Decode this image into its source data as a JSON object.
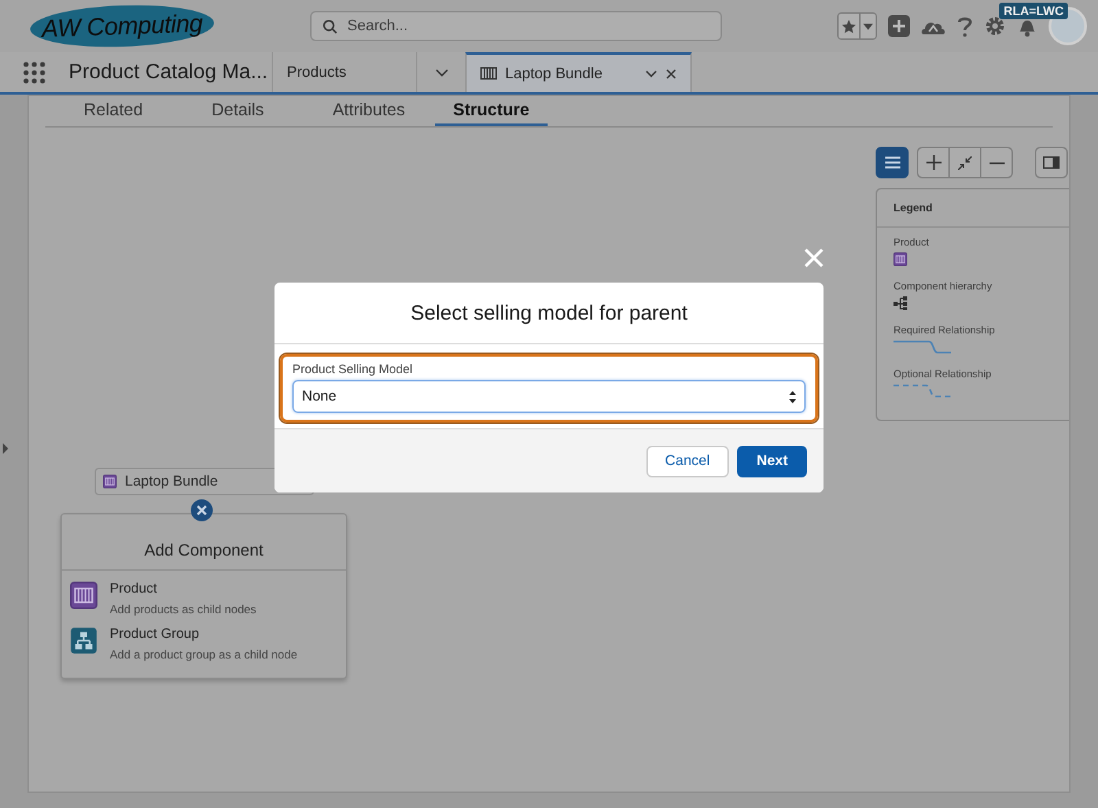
{
  "header": {
    "logo": "AW Computing",
    "search": {
      "placeholder": "Search..."
    },
    "badge": "RLA=LWC"
  },
  "nav": {
    "app_name": "Product Catalog Ma...",
    "tabs": [
      {
        "label": "Products",
        "kind": "object",
        "selected": false
      },
      {
        "label": "Laptop Bundle",
        "kind": "record",
        "selected": true
      }
    ]
  },
  "record_tabs": [
    {
      "label": "Related",
      "selected": false
    },
    {
      "label": "Details",
      "selected": false
    },
    {
      "label": "Attributes",
      "selected": false
    },
    {
      "label": "Structure",
      "selected": true
    }
  ],
  "legend": {
    "title": "Legend",
    "items": [
      {
        "label": "Product",
        "kind": "product"
      },
      {
        "label": "Component hierarchy",
        "kind": "hierarchy"
      },
      {
        "label": "Required Relationship",
        "kind": "required"
      },
      {
        "label": "Optional Relationship",
        "kind": "optional"
      }
    ]
  },
  "node": {
    "label": "Laptop Bundle"
  },
  "add_component": {
    "title": "Add Component",
    "options": [
      {
        "title": "Product",
        "description": "Add products as child nodes",
        "kind": "product"
      },
      {
        "title": "Product Group",
        "description": "Add a product group as a child node",
        "kind": "group"
      }
    ]
  },
  "modal": {
    "title": "Select selling model for parent",
    "field": {
      "label": "Product Selling Model",
      "value": "None"
    },
    "buttons": [
      {
        "label": "Cancel",
        "kind": "neutral"
      },
      {
        "label": "Next",
        "kind": "brand"
      }
    ]
  }
}
